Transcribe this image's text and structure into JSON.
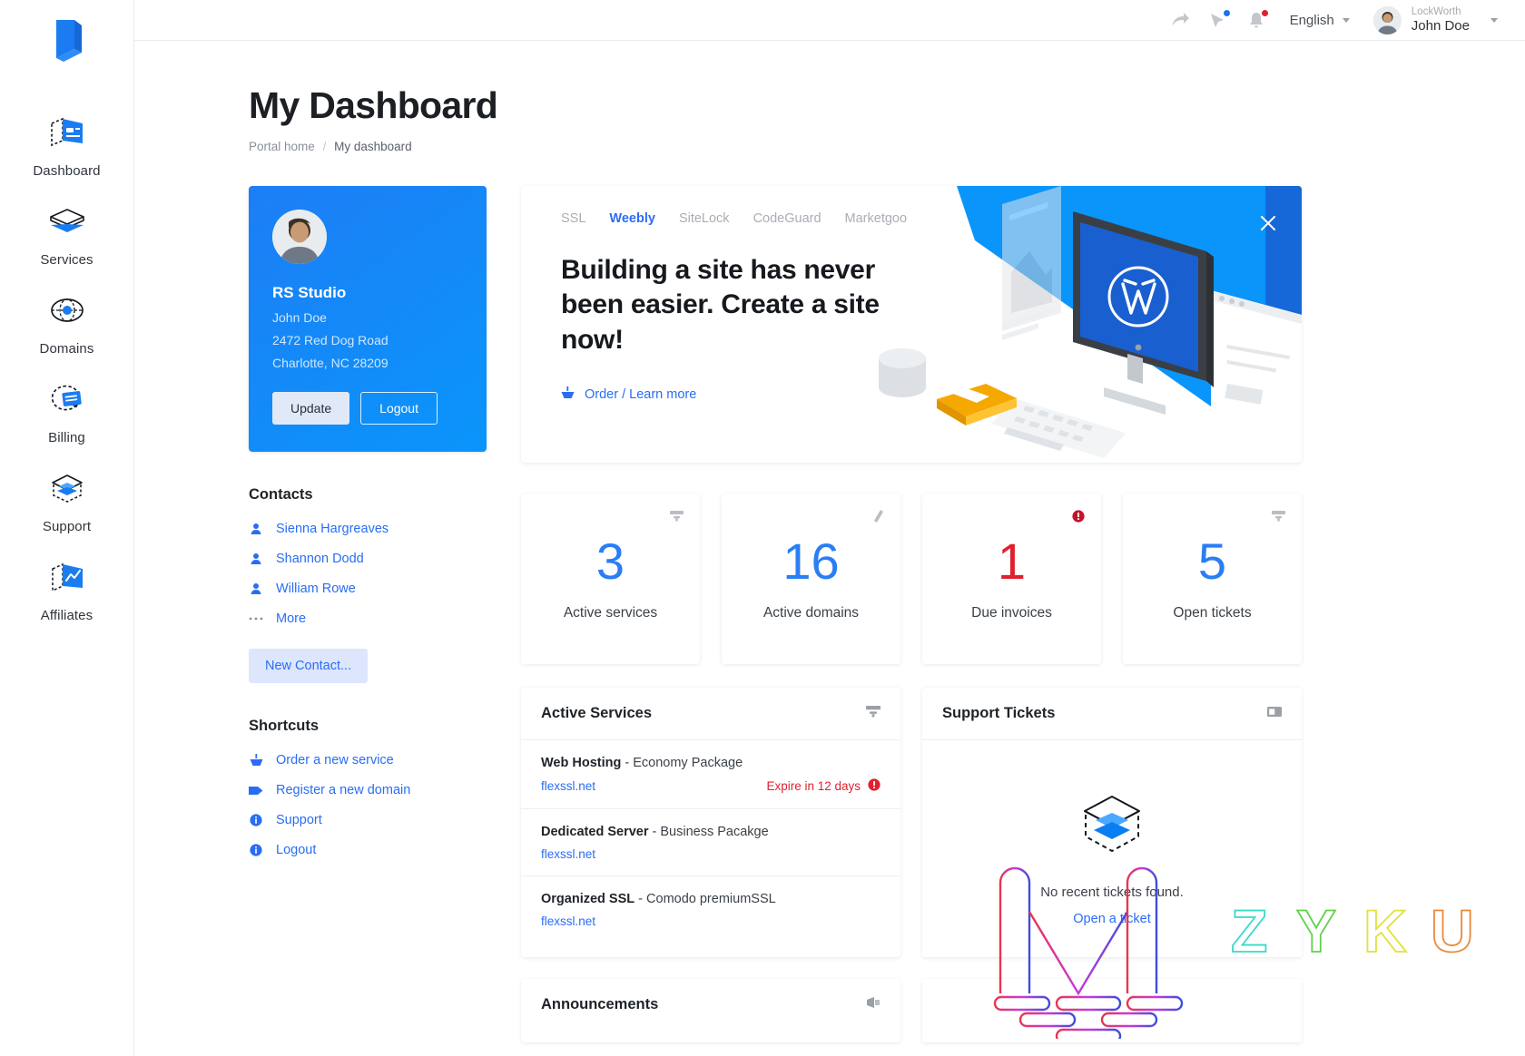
{
  "brand": {
    "logo_icon": "lockworth-logo-icon",
    "accent": "#0a8ffb",
    "accent_dark": "#2a6df5",
    "danger": "#e0202e"
  },
  "sidebar": {
    "items": [
      {
        "label": "Dashboard",
        "icon": "dashboard-icon"
      },
      {
        "label": "Services",
        "icon": "services-icon"
      },
      {
        "label": "Domains",
        "icon": "domains-icon"
      },
      {
        "label": "Billing",
        "icon": "billing-icon"
      },
      {
        "label": "Support",
        "icon": "support-icon"
      },
      {
        "label": "Affiliates",
        "icon": "affiliates-icon"
      }
    ]
  },
  "topbar": {
    "share_icon": "share-arrow-icon",
    "cursor_icon": "cursor-click-icon",
    "bell_icon": "bell-icon",
    "cursor_badge_color": "#1a73e8",
    "bell_badge_color": "#e0202e",
    "language": "English",
    "user": {
      "org": "LockWorth",
      "name": "John Doe",
      "avatar": "user-avatar"
    }
  },
  "page": {
    "title": "My Dashboard",
    "breadcrumb": {
      "home": "Portal home",
      "separator": "/",
      "current": "My dashboard"
    }
  },
  "profile": {
    "company": "RS Studio",
    "name": "John Doe",
    "street": "2472 Red Dog Road",
    "city": "Charlotte, NC 28209",
    "update_label": "Update",
    "logout_label": "Logout"
  },
  "contacts": {
    "title": "Contacts",
    "items": [
      {
        "label": "Sienna Hargreaves",
        "icon": "person-icon"
      },
      {
        "label": "Shannon Dodd",
        "icon": "person-icon"
      },
      {
        "label": "William Rowe",
        "icon": "person-icon"
      },
      {
        "label": "More",
        "icon": "ellipsis-icon"
      }
    ],
    "new_contact_label": "New Contact..."
  },
  "shortcuts": {
    "title": "Shortcuts",
    "items": [
      {
        "label": "Order a new service",
        "icon": "cart-icon"
      },
      {
        "label": "Register a new domain",
        "icon": "tag-icon"
      },
      {
        "label": "Support",
        "icon": "info-icon"
      },
      {
        "label": "Logout",
        "icon": "info-icon"
      }
    ]
  },
  "promo": {
    "tabs": [
      {
        "label": "SSL",
        "active": false
      },
      {
        "label": "Weebly",
        "active": true
      },
      {
        "label": "SiteLock",
        "active": false
      },
      {
        "label": "CodeGuard",
        "active": false
      },
      {
        "label": "Marketgoo",
        "active": false
      }
    ],
    "headline": "Building a site has never been easier. Create a site now!",
    "cta": "Order / Learn more",
    "cta_icon": "cart-icon",
    "close_icon": "close-icon",
    "art": "wordpress-isometric-illustration"
  },
  "stats": [
    {
      "value": "3",
      "label": "Active services",
      "icon": "server-icon",
      "color": "#2a7ef5",
      "badge": false
    },
    {
      "value": "16",
      "label": "Active domains",
      "icon": "tag-icon",
      "color": "#2a7ef5",
      "badge": false
    },
    {
      "value": "1",
      "label": "Due invoices",
      "icon": "alert-icon",
      "color": "#e0202e",
      "badge": true
    },
    {
      "value": "5",
      "label": "Open tickets",
      "icon": "server-icon",
      "color": "#2a7ef5",
      "badge": false
    }
  ],
  "active_services": {
    "title": "Active Services",
    "head_icon": "server-icon",
    "rows": [
      {
        "name": "Web Hosting",
        "package": "Economy Package",
        "domain": "flexssl.net",
        "status": "Expire in 12 days",
        "status_icon": "alert-icon"
      },
      {
        "name": "Dedicated Server",
        "package": "Business Pacakge",
        "domain": "flexssl.net",
        "status": "",
        "status_icon": ""
      },
      {
        "name": "Organized SSL",
        "package": "Comodo premiumSSL",
        "domain": "flexssl.net",
        "status": "",
        "status_icon": ""
      }
    ]
  },
  "support_tickets": {
    "title": "Support Tickets",
    "head_icon": "ticket-icon",
    "empty_icon": "empty-envelope-icon",
    "empty_text": "No recent tickets found.",
    "empty_link": "Open a ticket"
  },
  "announcements": {
    "title": "Announcements",
    "head_icon": "megaphone-icon"
  },
  "watermark": {
    "logo": "M",
    "letters": [
      "Z",
      "Y",
      "K",
      "U"
    ]
  }
}
